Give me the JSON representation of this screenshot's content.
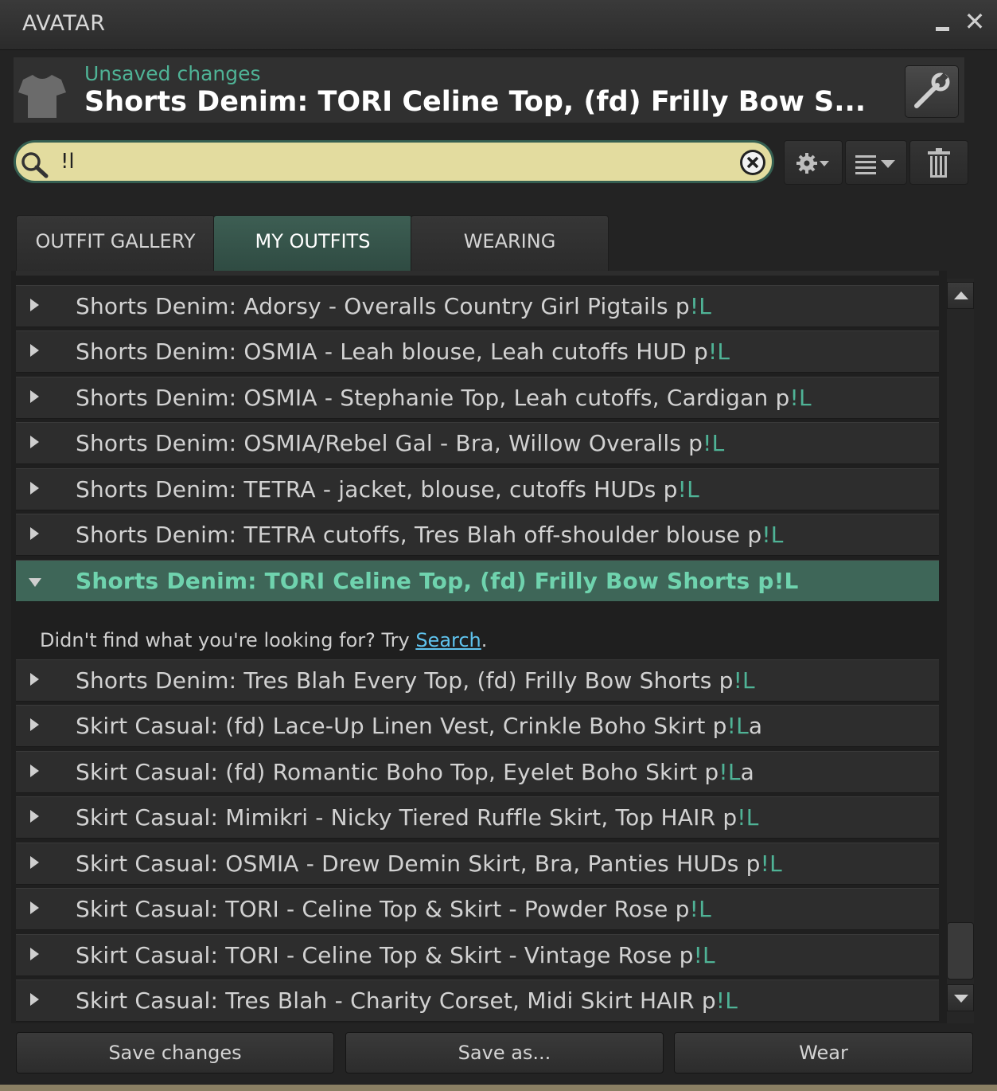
{
  "window": {
    "title": "AVATAR"
  },
  "header": {
    "status": "Unsaved changes",
    "outfit_title": "Shorts Denim: TORI Celine Top, (fd) Frilly Bow S..."
  },
  "search": {
    "value": "!l"
  },
  "tabs": [
    {
      "label": "OUTFIT GALLERY",
      "active": false
    },
    {
      "label": "MY OUTFITS",
      "active": true
    },
    {
      "label": "WEARING",
      "active": false
    }
  ],
  "outfits": [
    {
      "name": "Shorts Denim: Adorsy - Overalls Country Girl Pigtails p",
      "tag": "!L",
      "suffix": ""
    },
    {
      "name": "Shorts Denim: OSMIA - Leah blouse, Leah cutoffs HUD p",
      "tag": "!L",
      "suffix": ""
    },
    {
      "name": "Shorts Denim: OSMIA - Stephanie Top, Leah cutoffs, Cardigan p",
      "tag": "!L",
      "suffix": ""
    },
    {
      "name": "Shorts Denim: OSMIA/Rebel Gal - Bra, Willow Overalls p",
      "tag": "!L",
      "suffix": ""
    },
    {
      "name": "Shorts Denim: TETRA - jacket, blouse, cutoffs HUDs p",
      "tag": "!L",
      "suffix": ""
    },
    {
      "name": "Shorts Denim: TETRA cutoffs, Tres Blah off-shoulder blouse p",
      "tag": "!L",
      "suffix": ""
    },
    {
      "name": "Shorts Denim: TORI Celine Top, (fd) Frilly Bow Shorts p!L",
      "tag": "",
      "suffix": "",
      "selected": true
    },
    {
      "name": "Shorts Denim: Tres Blah Every Top, (fd) Frilly Bow Shorts p",
      "tag": "!L",
      "suffix": ""
    },
    {
      "name": "Skirt Casual: (fd) Lace-Up Linen Vest, Crinkle Boho Skirt p",
      "tag": "!L",
      "suffix": "a"
    },
    {
      "name": "Skirt Casual: (fd) Romantic Boho Top, Eyelet Boho Skirt p",
      "tag": "!L",
      "suffix": "a"
    },
    {
      "name": "Skirt Casual: Mimikri - Nicky Tiered Ruffle Skirt, Top HAIR p",
      "tag": "!L",
      "suffix": ""
    },
    {
      "name": "Skirt Casual: OSMIA - Drew Demin Skirt, Bra, Panties HUDs p",
      "tag": "!L",
      "suffix": ""
    },
    {
      "name": "Skirt Casual: TORI - Celine Top & Skirt - Powder Rose p",
      "tag": "!L",
      "suffix": ""
    },
    {
      "name": "Skirt Casual: TORI - Celine Top & Skirt - Vintage Rose p",
      "tag": "!L",
      "suffix": ""
    },
    {
      "name": "Skirt Casual: Tres Blah - Charity Corset, Midi Skirt HAIR p",
      "tag": "!L",
      "suffix": ""
    }
  ],
  "not_found": {
    "prefix": "Didn't find what you're looking for? Try ",
    "link": "Search",
    "suffix": "."
  },
  "buttons": {
    "save": "Save changes",
    "save_as": "Save as...",
    "wear": "Wear"
  },
  "icons": {
    "tshirt": "tshirt-icon",
    "wrench": "wrench-icon",
    "search": "search-icon",
    "clear": "clear-icon",
    "gear": "gear-icon",
    "sort": "sort-icon",
    "trash": "trash-icon"
  },
  "colors": {
    "accent": "#4fb396",
    "selected_row": "#3e6658",
    "search_bg": "#e3dc9f",
    "link": "#5fc3ee"
  }
}
